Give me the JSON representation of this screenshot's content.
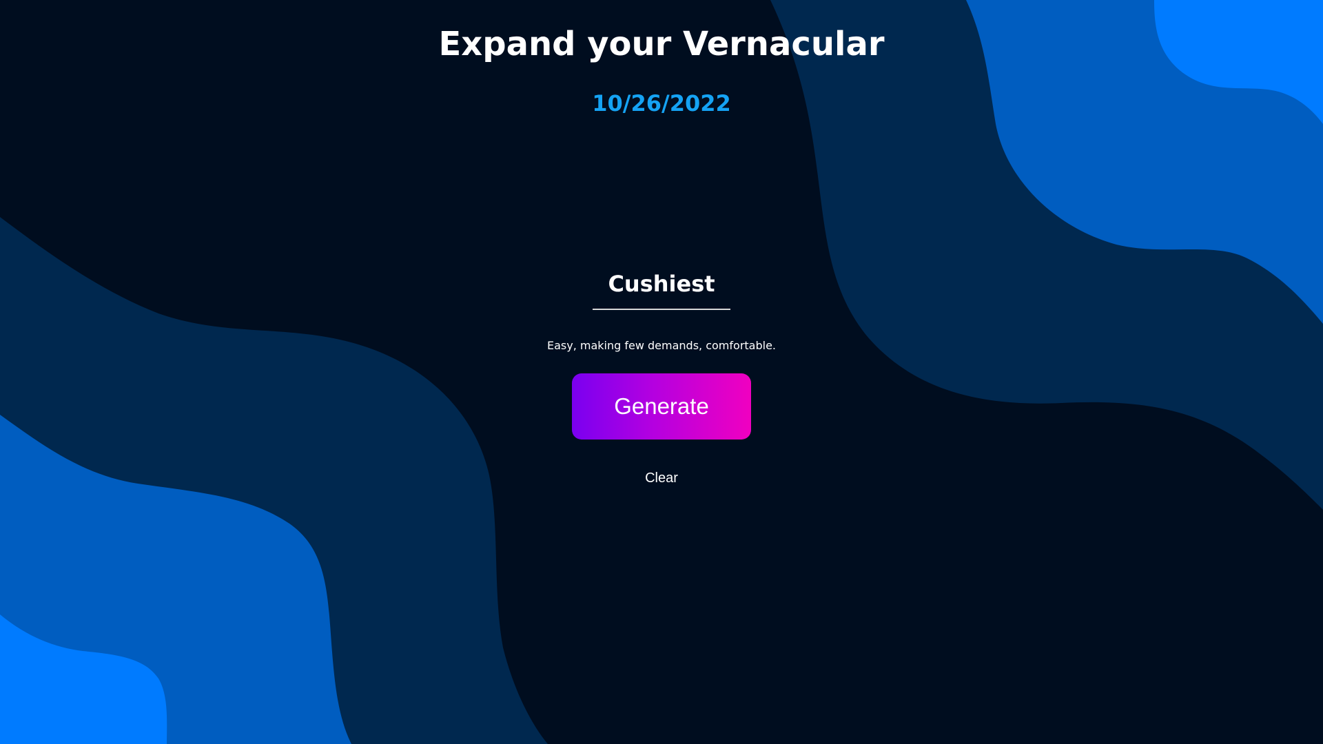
{
  "page": {
    "title": "Expand your Vernacular",
    "date": "10/26/2022"
  },
  "word_card": {
    "word": "Cushiest",
    "definition": "Easy, making few demands, comfortable."
  },
  "actions": {
    "generate_label": "Generate",
    "clear_label": "Clear"
  },
  "theme": {
    "background": "#000d1f",
    "wave_dark": "#00284f",
    "wave_mid": "#005dc0",
    "wave_light": "#007bff",
    "date_color": "#15a3f4",
    "button_gradient_start": "#7a00f0",
    "button_gradient_end": "#f000c0"
  }
}
